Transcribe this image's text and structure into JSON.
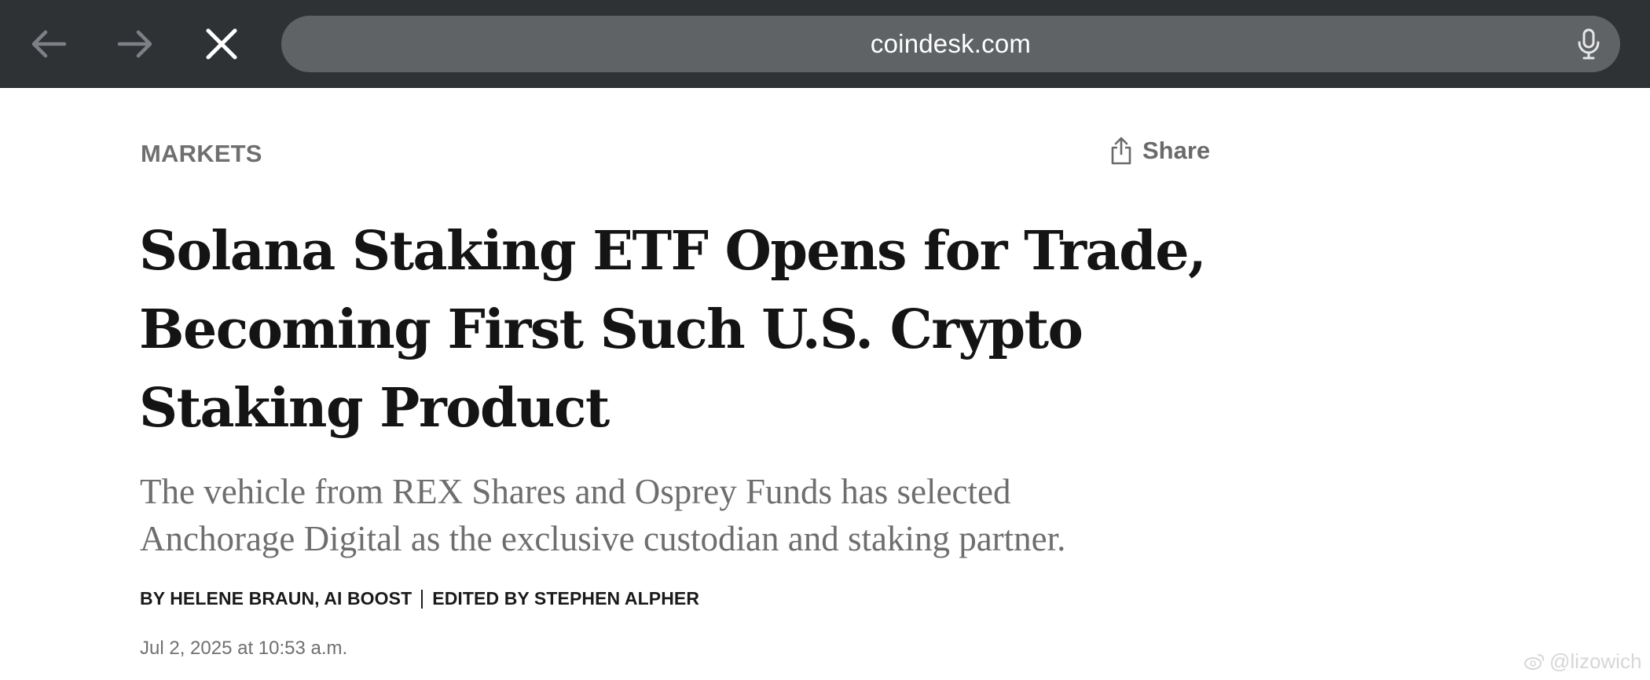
{
  "browser": {
    "url": "coindesk.com",
    "icons": {
      "back": "arrow-left-icon",
      "forward": "arrow-right-icon",
      "stop": "close-icon",
      "mic": "microphone-icon"
    },
    "colors": {
      "toolbar": "#2f3235",
      "address_bar": "#5f6366"
    }
  },
  "article": {
    "category": "MARKETS",
    "share_label": "Share",
    "headline": "Solana Staking ETF Opens for Trade, Becoming First Such U.S. Crypto Staking Product",
    "subtitle": "The vehicle from REX Shares and Osprey Funds has selected Anchorage Digital as the exclusive custodian and staking partner.",
    "byline_authors": "BY HELENE BRAUN, AI BOOST",
    "byline_editor": "EDITED BY STEPHEN ALPHER",
    "date": "Jul 2, 2025 at 10:53 a.m."
  },
  "watermark": {
    "text": "@lizowich",
    "icon": "weibo-logo-icon"
  }
}
